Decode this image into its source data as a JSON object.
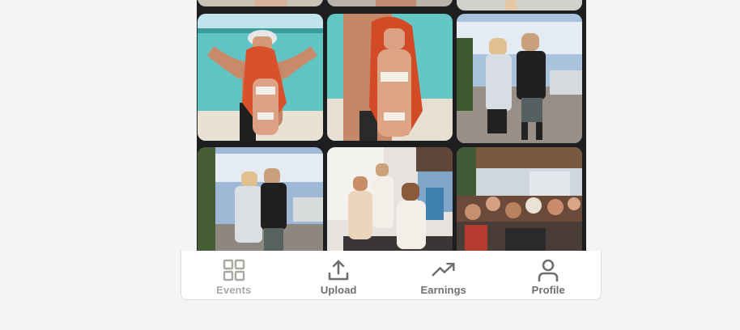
{
  "colors": {
    "background": "#f3f4f3",
    "gallery_bg": "#1e1d1f",
    "nav_active": "#a8aaa3",
    "nav_default": "#6e6f72"
  },
  "gallery": {
    "photos": [
      {
        "scene": "beach-couple-flex"
      },
      {
        "scene": "beach-couple-pose"
      },
      {
        "scene": "promenade-pair"
      },
      {
        "scene": "promenade-pair-alt"
      },
      {
        "scene": "party-crowd-terrace"
      },
      {
        "scene": "party-crowd-dj"
      }
    ]
  },
  "nav": {
    "items": [
      {
        "label": "Events",
        "icon": "grid-icon",
        "active": true
      },
      {
        "label": "Upload",
        "icon": "upload-icon",
        "active": false
      },
      {
        "label": "Earnings",
        "icon": "trending-up-icon",
        "active": false
      },
      {
        "label": "Profile",
        "icon": "person-icon",
        "active": false
      }
    ]
  }
}
